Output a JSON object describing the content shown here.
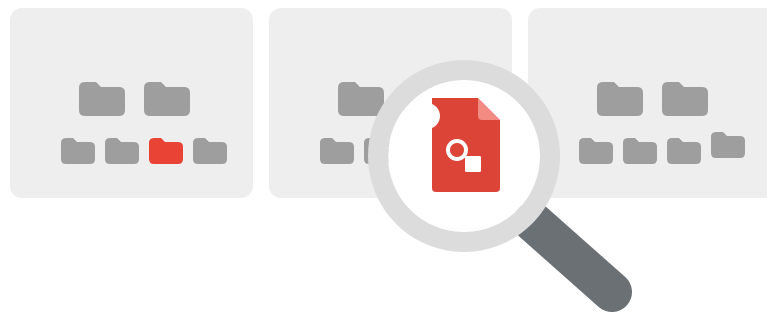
{
  "illustration": {
    "subject": "search-files-illustration",
    "panel_count": 3,
    "highlighted_folder": {
      "panel": 1,
      "row": 2,
      "index": 3
    },
    "found_document": "drawing-document-icon"
  },
  "colors": {
    "background": "#ffffff",
    "panel": "#eeeeee",
    "folder": "#9e9e9e",
    "folder_highlight": "#e84335",
    "document": "#db4437",
    "document_fold": "#f28b82",
    "document_glyph": "#ffffff",
    "lens_ring": "#dcdcdc",
    "lens_glass": "#ffffff",
    "lens_glint": "#ffffff",
    "handle": "#6b7075"
  }
}
